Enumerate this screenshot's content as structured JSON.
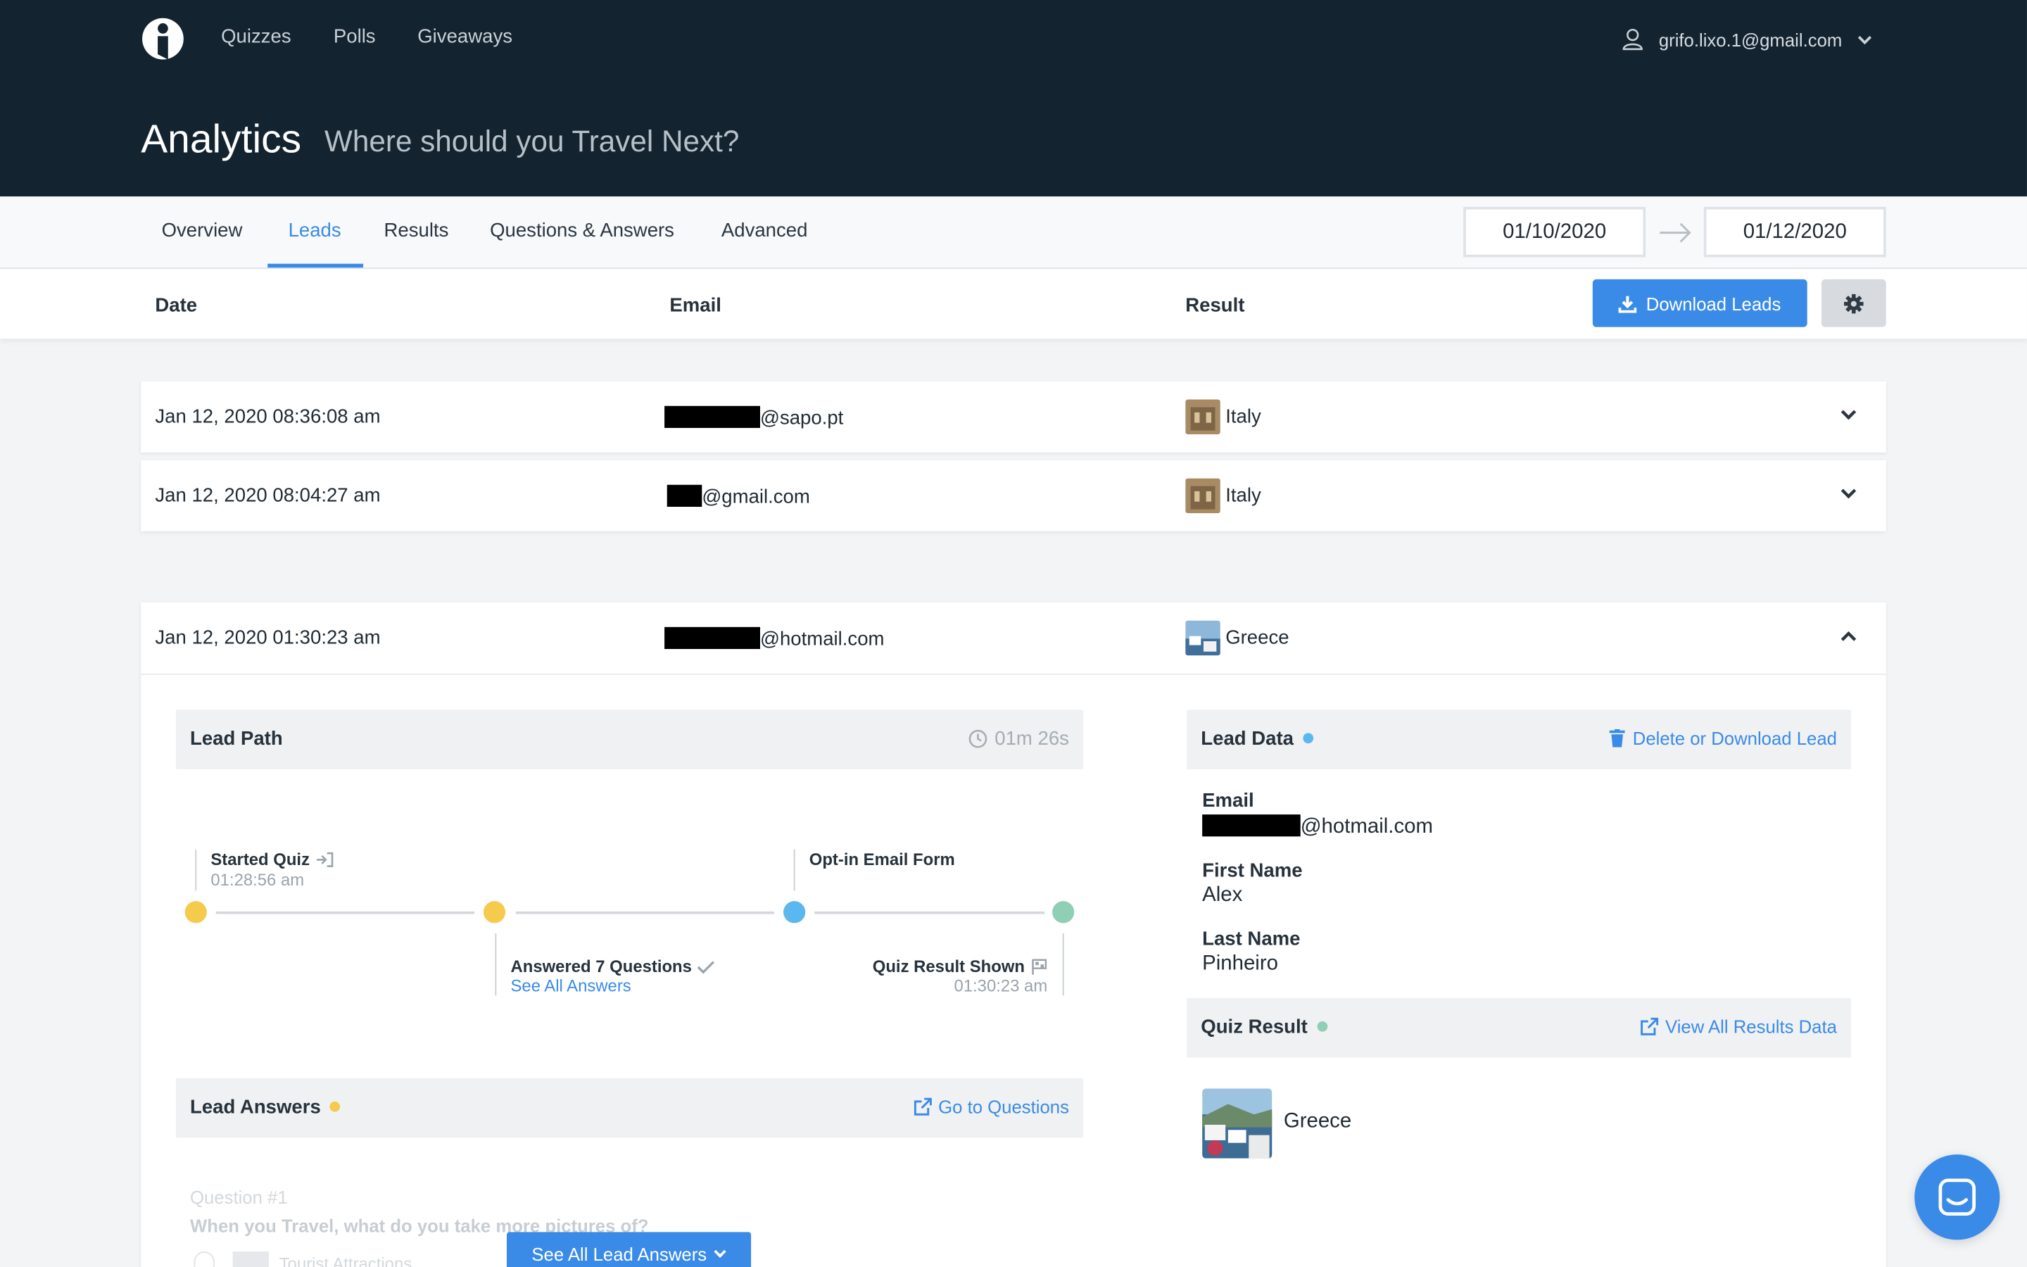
{
  "nav": {
    "links": [
      "Quizzes",
      "Polls",
      "Giveaways"
    ],
    "user_email": "grifo.lixo.1@gmail.com"
  },
  "header": {
    "title": "Analytics",
    "subtitle": "Where should you Travel Next?"
  },
  "tabs": [
    "Overview",
    "Leads",
    "Results",
    "Questions & Answers",
    "Advanced"
  ],
  "active_tab": "Leads",
  "date_range": {
    "from": "01/10/2020",
    "to": "01/12/2020"
  },
  "table": {
    "columns": {
      "date": "Date",
      "email": "Email",
      "result": "Result"
    },
    "download_label": "Download Leads"
  },
  "leads": [
    {
      "date": "Jan 12, 2020 08:36:08 am",
      "email_suffix": "@sapo.pt",
      "result": "Italy"
    },
    {
      "date": "Jan 12, 2020 08:04:27 am",
      "email_suffix": "@gmail.com",
      "result": "Italy"
    },
    {
      "date": "Jan 12, 2020 01:30:23 am",
      "email_suffix": "@hotmail.com",
      "result": "Greece"
    }
  ],
  "detail": {
    "lead_path": {
      "title": "Lead Path",
      "duration": "01m 26s",
      "started_label": "Started Quiz",
      "started_time": "01:28:56 am",
      "answered_label": "Answered 7 Questions",
      "see_answers": "See All Answers",
      "optin_label": "Opt-in Email Form",
      "result_label": "Quiz Result Shown",
      "result_time": "01:30:23 am"
    },
    "lead_answers": {
      "title": "Lead Answers",
      "link": "Go to Questions",
      "question_num": "Question #1",
      "question_text": "When you Travel, what do you take more pictures of?",
      "answer_text": "Tourist Attractions",
      "see_all_button": "See All Lead Answers"
    },
    "lead_data": {
      "title": "Lead Data",
      "link": "Delete or Download Lead",
      "email_label": "Email",
      "email_suffix": "@hotmail.com",
      "first_name_label": "First Name",
      "first_name": "Alex",
      "last_name_label": "Last Name",
      "last_name": "Pinheiro"
    },
    "quiz_result": {
      "title": "Quiz Result",
      "link": "View All Results Data",
      "result": "Greece"
    }
  },
  "colors": {
    "accent": "#3a8be8",
    "topbar": "#13232f",
    "dot_yellow": "#f5cb4d",
    "dot_blue": "#5bb8ef",
    "dot_green": "#8fcfb6"
  }
}
